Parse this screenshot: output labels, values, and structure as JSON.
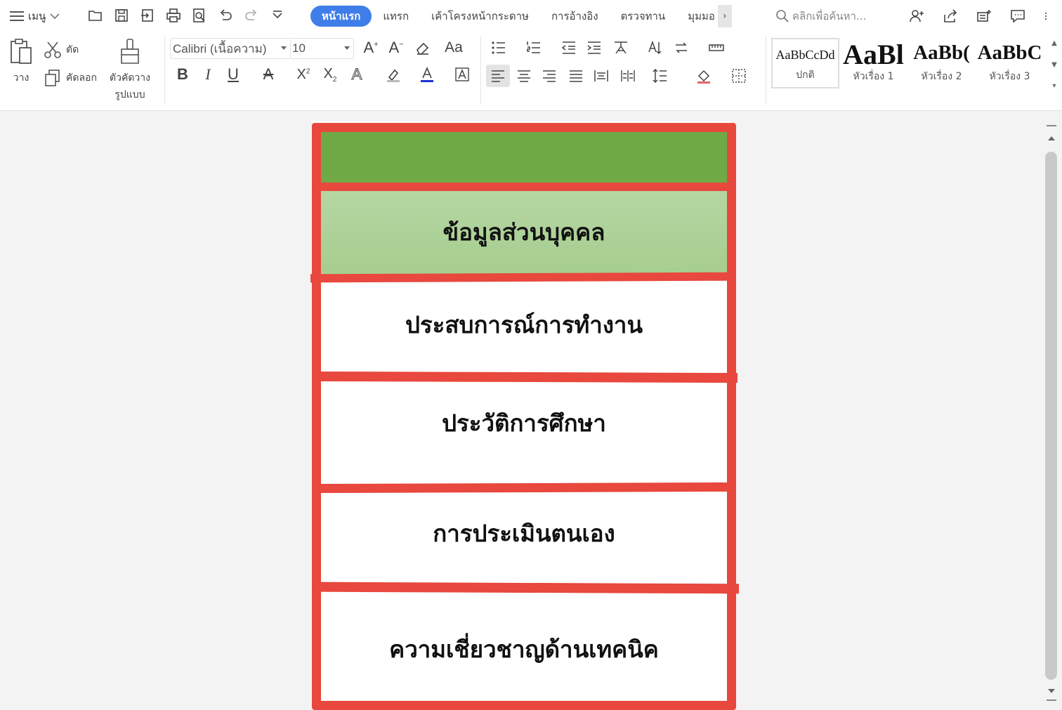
{
  "topbar": {
    "menu_label": "เมนู",
    "tabs": [
      {
        "label": "หน้าแรก",
        "active": true
      },
      {
        "label": "แทรก",
        "active": false
      },
      {
        "label": "เค้าโครงหน้ากระดาษ",
        "active": false
      },
      {
        "label": "การอ้างอิง",
        "active": false
      },
      {
        "label": "ตรวจทาน",
        "active": false
      },
      {
        "label": "มุมมอ",
        "active": false
      }
    ],
    "tab_more": "›",
    "search_placeholder": "คลิกเพื่อค้นหา..."
  },
  "ribbon": {
    "paste_label": "วาง",
    "cut_label": "ตัด",
    "copy_label": "คัดลอก",
    "format_painter_label_1": "ตัวคัดวาง",
    "format_painter_label_2": "รูปแบบ",
    "font_name": "Calibri (เนื้อความ)",
    "font_size": "10",
    "styles": [
      {
        "sample": "AaBbCcDd",
        "label": "ปกติ"
      },
      {
        "sample": "AaBl",
        "label": "หัวเรื่อง 1"
      },
      {
        "sample": "AaBb(",
        "label": "หัวเรื่อง 2"
      },
      {
        "sample": "AaBbC",
        "label": "หัวเรื่อง 3"
      }
    ]
  },
  "document": {
    "sections": [
      {
        "text": "ข้อมูลส่วนบุคคล"
      },
      {
        "text": "ประสบการณ์การทำงาน"
      },
      {
        "text": "ประวัติการศึกษา"
      },
      {
        "text": "การประเมินตนเอง"
      },
      {
        "text": "ความเชี่ยวชาญด้านเทคนิค"
      }
    ]
  },
  "colors": {
    "accent_tab": "#3f7ee8",
    "header_green": "#6faa46",
    "section_green": "#b0d39e",
    "frame_red": "#e8483d"
  }
}
